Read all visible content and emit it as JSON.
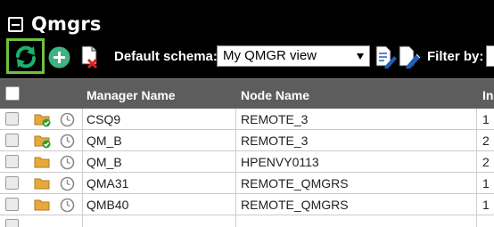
{
  "header": {
    "title": "Qmgrs"
  },
  "toolbar": {
    "schema_label": "Default schema:",
    "schema_value": "My QMGR view",
    "filter_label": "Filter by:",
    "filter_value": "",
    "accent_color": "#6fc13f"
  },
  "table": {
    "columns": [
      {
        "label": "Manager Name"
      },
      {
        "label": "Node Name"
      },
      {
        "label": "In"
      }
    ],
    "rows": [
      {
        "manager": "CSQ9",
        "node": "REMOTE_3",
        "col3": "1",
        "status_icon": "folder-check-icon"
      },
      {
        "manager": "QM_B",
        "node": "REMOTE_3",
        "col3": "2",
        "status_icon": "folder-check-icon"
      },
      {
        "manager": "QM_B",
        "node": "HPENVY0113",
        "col3": "2",
        "status_icon": "folder-icon"
      },
      {
        "manager": "QMA31",
        "node": "REMOTE_QMGRS",
        "col3": "1",
        "status_icon": "folder-icon"
      },
      {
        "manager": "QMB40",
        "node": "REMOTE_QMGRS",
        "col3": "1",
        "status_icon": "folder-icon"
      }
    ]
  }
}
